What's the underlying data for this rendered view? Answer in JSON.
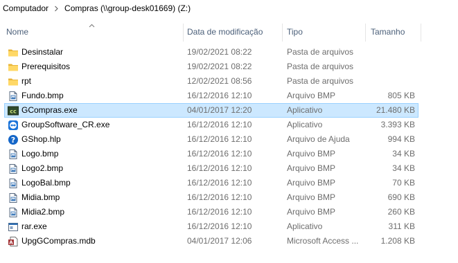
{
  "breadcrumb": {
    "items": [
      "Computador",
      "Compras (\\\\group-desk01669) (Z:)"
    ]
  },
  "columns": {
    "name": "Nome",
    "date": "Data de modificação",
    "type": "Tipo",
    "size": "Tamanho"
  },
  "files": [
    {
      "name": "Desinstalar",
      "date": "19/02/2021 08:22",
      "type": "Pasta de arquivos",
      "size": "",
      "icon": "folder-icon"
    },
    {
      "name": "Prerequisitos",
      "date": "19/02/2021 08:22",
      "type": "Pasta de arquivos",
      "size": "",
      "icon": "folder-icon"
    },
    {
      "name": "rpt",
      "date": "12/02/2021 08:56",
      "type": "Pasta de arquivos",
      "size": "",
      "icon": "folder-icon"
    },
    {
      "name": "Fundo.bmp",
      "date": "16/12/2016 12:10",
      "type": "Arquivo BMP",
      "size": "805 KB",
      "icon": "image-file-icon"
    },
    {
      "name": "GCompras.exe",
      "date": "04/01/2017 12:20",
      "type": "Aplicativo",
      "size": "21.480 KB",
      "icon": "gcompras-app-icon",
      "selected": true
    },
    {
      "name": "GroupSoftware_CR.exe",
      "date": "16/12/2016 12:10",
      "type": "Aplicativo",
      "size": "3.393 KB",
      "icon": "teamviewer-app-icon"
    },
    {
      "name": "GShop.hlp",
      "date": "16/12/2016 12:10",
      "type": "Arquivo de Ajuda",
      "size": "994 KB",
      "icon": "help-file-icon"
    },
    {
      "name": "Logo.bmp",
      "date": "16/12/2016 12:10",
      "type": "Arquivo BMP",
      "size": "34 KB",
      "icon": "image-file-icon"
    },
    {
      "name": "Logo2.bmp",
      "date": "16/12/2016 12:10",
      "type": "Arquivo BMP",
      "size": "34 KB",
      "icon": "image-file-icon"
    },
    {
      "name": "LogoBal.bmp",
      "date": "16/12/2016 12:10",
      "type": "Arquivo BMP",
      "size": "70 KB",
      "icon": "image-file-icon"
    },
    {
      "name": "Midia.bmp",
      "date": "16/12/2016 12:10",
      "type": "Arquivo BMP",
      "size": "690 KB",
      "icon": "image-file-icon"
    },
    {
      "name": "Midia2.bmp",
      "date": "16/12/2016 12:10",
      "type": "Arquivo BMP",
      "size": "260 KB",
      "icon": "image-file-icon"
    },
    {
      "name": "rar.exe",
      "date": "16/12/2016 12:10",
      "type": "Aplicativo",
      "size": "311 KB",
      "icon": "exe-file-icon"
    },
    {
      "name": "UpgGCompras.mdb",
      "date": "04/01/2017 12:06",
      "type": "Microsoft Access ...",
      "size": "1.208 KB",
      "icon": "access-db-icon"
    }
  ]
}
